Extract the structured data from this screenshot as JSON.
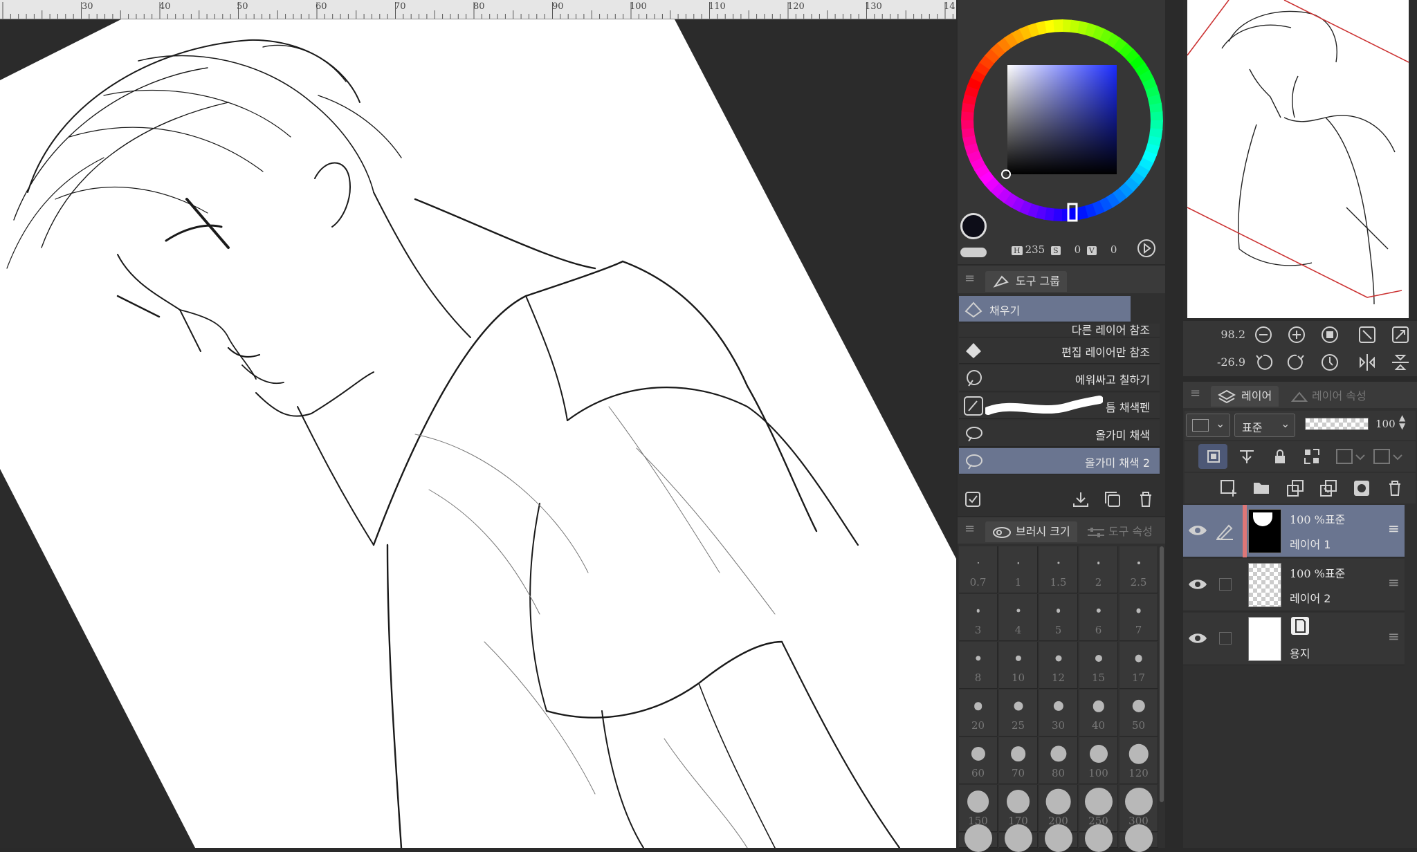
{
  "ruler": {
    "labels": [
      "30",
      "40",
      "50",
      "60",
      "70",
      "80",
      "90",
      "100",
      "110",
      "120",
      "130",
      "14"
    ]
  },
  "color": {
    "h_label": "H",
    "h_value": "235",
    "s_label": "S",
    "s_value": "0",
    "v_label": "V",
    "v_value": "0",
    "main_color": "#0d0d18",
    "sub_color": "#ffffff"
  },
  "tool_panel": {
    "tab_label": "도구 그룹",
    "items": [
      {
        "label": "채우기",
        "selected": true
      },
      {
        "label": "다른 레이어 참조",
        "selected": false
      },
      {
        "label": "편집 레이어만 참조",
        "selected": false
      },
      {
        "label": "에워싸고 칠하기",
        "selected": false
      },
      {
        "label": "틈 채색펜",
        "selected": false
      },
      {
        "label": "올가미 채색",
        "selected": false
      },
      {
        "label": "올가미 채색 2",
        "selected": true
      }
    ]
  },
  "brush_panel": {
    "tab_label": "브러시 크기",
    "tab2_label": "도구 속성",
    "sizes": [
      "0.7",
      "1",
      "1.5",
      "2",
      "2.5",
      "3",
      "4",
      "5",
      "6",
      "7",
      "8",
      "10",
      "12",
      "15",
      "17",
      "20",
      "25",
      "30",
      "40",
      "50",
      "60",
      "70",
      "80",
      "100",
      "120",
      "150",
      "170",
      "200",
      "250",
      "300"
    ]
  },
  "navigator": {
    "zoom_value": "98.2",
    "rotation_value": "-26.9"
  },
  "layer_panel": {
    "tab_label": "레이어",
    "tab2_label": "레이어 속성",
    "blend_mode": "표준",
    "opacity": "100",
    "layers": [
      {
        "mode": "100 %표준",
        "name": "레이어 1",
        "selected": true
      },
      {
        "mode": "100 %표준",
        "name": "레이어 2",
        "selected": false
      },
      {
        "mode": "",
        "name": "용지",
        "selected": false
      }
    ]
  }
}
